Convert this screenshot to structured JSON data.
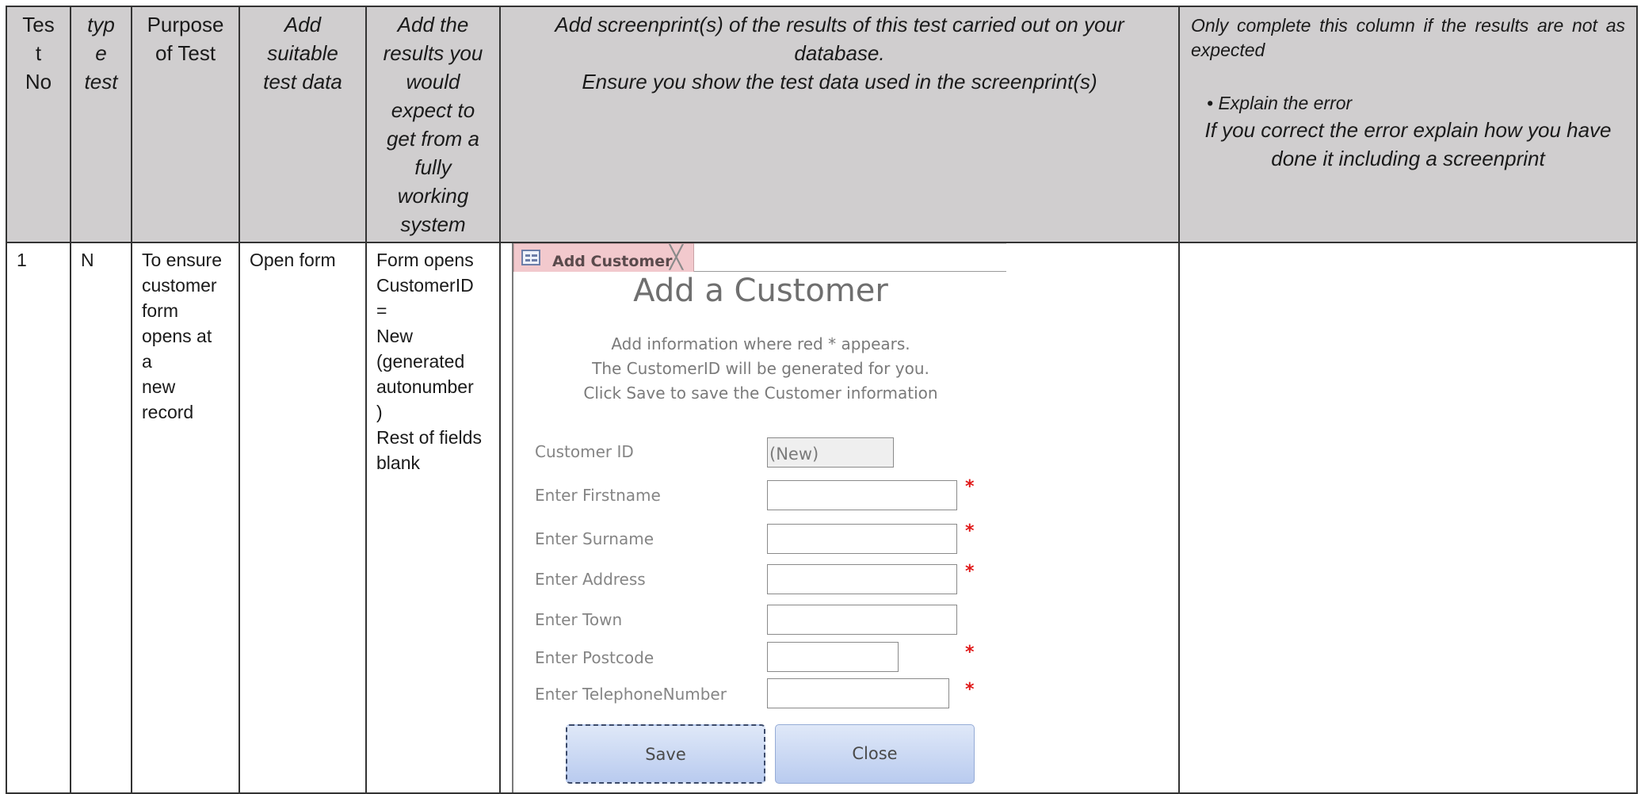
{
  "headers": {
    "test_no": [
      "Tes",
      "t",
      "No"
    ],
    "type": [
      "typ",
      "e",
      "test"
    ],
    "purpose": [
      "Purpose",
      "of Test"
    ],
    "test_data": [
      "Add",
      "suitable",
      "test data"
    ],
    "expected": [
      "Add the",
      "results you",
      "would",
      "expect to",
      "get from a",
      "fully",
      "working",
      "system"
    ],
    "screenprint": [
      "Add screenprint(s) of the results of this test carried out on your",
      "database.",
      "Ensure you show the test data used in the screenprint(s)"
    ],
    "errors_intro": "Only complete this column if the results are not as expected",
    "errors_bullet": "Explain the error",
    "errors_correct": [
      "If you correct the error explain how you have",
      "done it including a screenprint"
    ]
  },
  "row": {
    "test_no": "1",
    "type": "N",
    "purpose": [
      "To ensure",
      "customer",
      "form",
      "opens at",
      "a new",
      "record"
    ],
    "test_data": "Open form",
    "expected": [
      "Form opens",
      "CustomerID",
      "= New",
      "(generated",
      "autonumber",
      ")",
      "Rest of fields",
      "blank"
    ],
    "errors": ""
  },
  "form": {
    "tab_title": "Add Customer",
    "tab_close": "╳",
    "title": "Add a Customer",
    "instructions": [
      "Add information where red * appears.",
      "The CustomerID will be generated for you.",
      "Click Save to save the Customer information"
    ],
    "fields": [
      {
        "label": "Customer ID",
        "value": "(New)",
        "required": false
      },
      {
        "label": "Enter Firstname",
        "value": "",
        "required": true
      },
      {
        "label": "Enter Surname",
        "value": "",
        "required": true
      },
      {
        "label": "Enter Address",
        "value": "",
        "required": true
      },
      {
        "label": "Enter Town",
        "value": "",
        "required": false
      },
      {
        "label": "Enter Postcode",
        "value": "",
        "required": true
      },
      {
        "label": "Enter TelephoneNumber",
        "value": "",
        "required": true
      }
    ],
    "required_marker": "*",
    "save_label": "Save",
    "close_label": "Close"
  },
  "colors": {
    "header_bg": "#d0cecf",
    "tab_bg": "#f2c9cd",
    "required": "#e01818",
    "button": "#c8d6f3"
  }
}
